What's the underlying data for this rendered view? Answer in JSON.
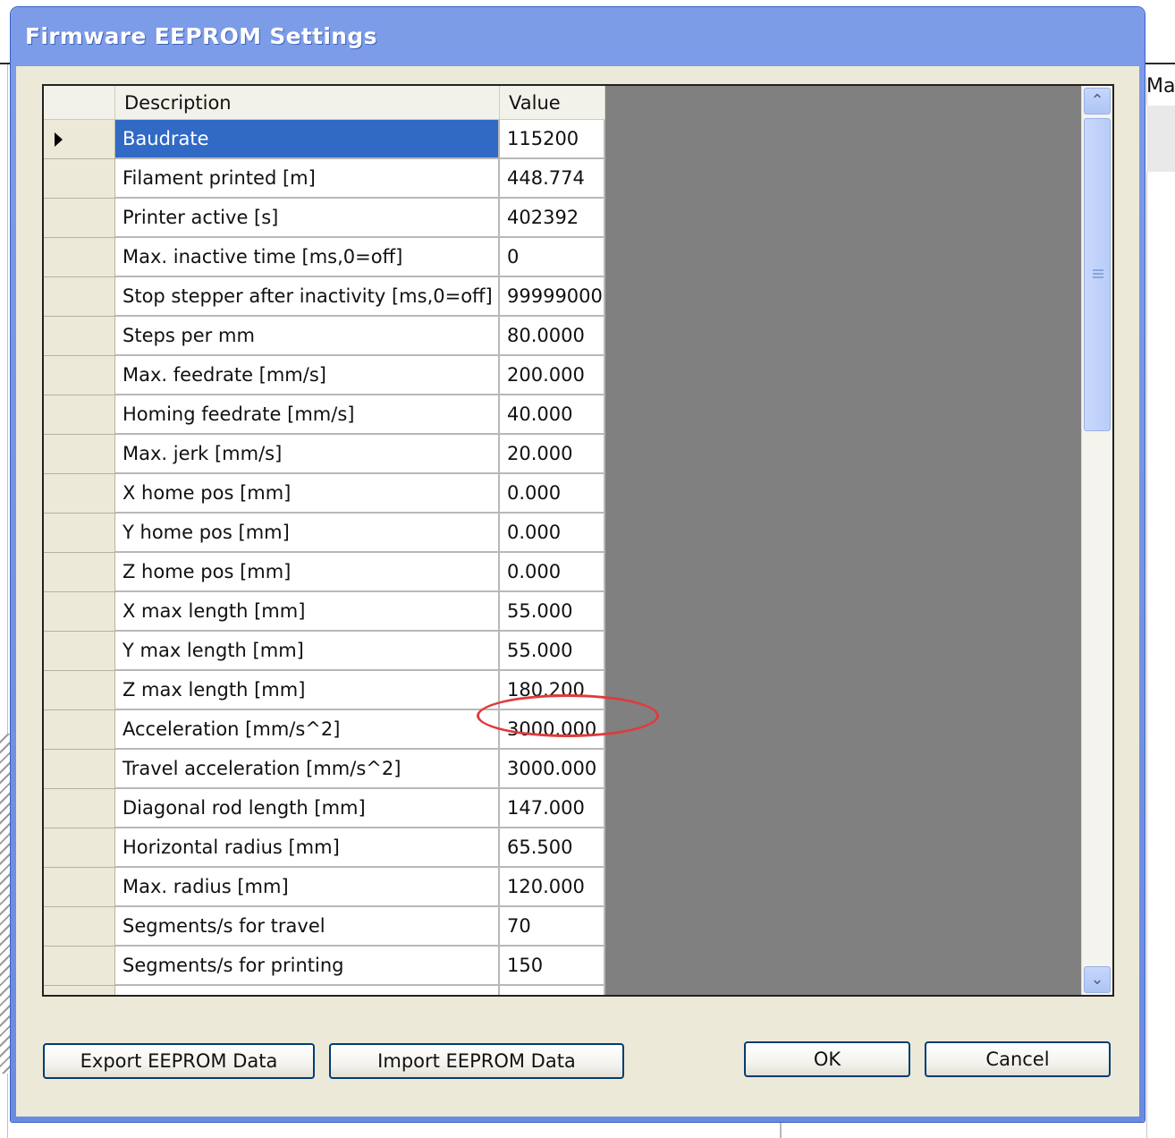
{
  "background": {
    "right_label": "Man"
  },
  "dialog": {
    "title": "Firmware EEPROM Settings"
  },
  "grid": {
    "columns": {
      "description": "Description",
      "value": "Value"
    },
    "rows": [
      {
        "description": "Baudrate",
        "value": "115200",
        "selected": true
      },
      {
        "description": "Filament printed [m]",
        "value": "448.774"
      },
      {
        "description": "Printer active [s]",
        "value": "402392"
      },
      {
        "description": "Max. inactive time [ms,0=off]",
        "value": "0"
      },
      {
        "description": "Stop stepper after inactivity [ms,0=off]",
        "value": "99999000"
      },
      {
        "description": "Steps per mm",
        "value": "80.0000"
      },
      {
        "description": "Max. feedrate [mm/s]",
        "value": "200.000"
      },
      {
        "description": "Homing feedrate [mm/s]",
        "value": "40.000"
      },
      {
        "description": "Max. jerk [mm/s]",
        "value": "20.000"
      },
      {
        "description": "X home pos [mm]",
        "value": "0.000"
      },
      {
        "description": "Y home pos [mm]",
        "value": "0.000"
      },
      {
        "description": "Z home pos [mm]",
        "value": "0.000"
      },
      {
        "description": "X max length [mm]",
        "value": "55.000"
      },
      {
        "description": "Y max length [mm]",
        "value": "55.000"
      },
      {
        "description": "Z max length [mm]",
        "value": "180.200",
        "annotated": true
      },
      {
        "description": "Acceleration [mm/s^2]",
        "value": "3000.000"
      },
      {
        "description": "Travel acceleration [mm/s^2]",
        "value": "3000.000"
      },
      {
        "description": "Diagonal rod length [mm]",
        "value": "147.000"
      },
      {
        "description": "Horizontal radius [mm]",
        "value": "65.500"
      },
      {
        "description": "Max. radius [mm]",
        "value": "120.000"
      },
      {
        "description": "Segments/s for travel",
        "value": "70"
      },
      {
        "description": "Segments/s for printing",
        "value": "150"
      },
      {
        "description": "",
        "value": ""
      }
    ]
  },
  "buttons": {
    "export": "Export EEPROM Data",
    "import": "Import EEPROM Data",
    "ok": "OK",
    "cancel": "Cancel"
  },
  "annotation_color": "#e03a3a",
  "selection_color": "#316ac5"
}
